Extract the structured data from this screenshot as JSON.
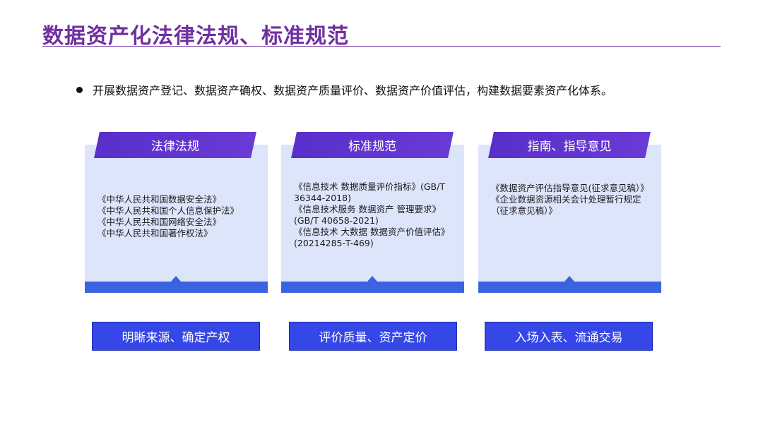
{
  "header": {
    "title": "数据资产化法律法规、标准规范"
  },
  "intro": {
    "bullet": "开展数据资产登记、数据资产确权、数据资产质量评价、数据资产价值评估，构建数据要素资产化体系。"
  },
  "columns": [
    {
      "tab": "法律法规",
      "lines": [
        "《中华人民共和国数据安全法》",
        "《中华人民共和国个人信息保护法》",
        "《中华人民共和国网络安全法》",
        "《中华人民共和国著作权法》"
      ],
      "action": "明晰来源、确定产权"
    },
    {
      "tab": "标准规范",
      "lines": [
        "《信息技术 数据质量评价指标》(GB/T 36344-2018)",
        "《信息技术服务 数据资产 管理要求》(GB/T 40658-2021)",
        "《信息技术 大数据 数据资产价值评估》(20214285-T-469)"
      ],
      "action": "评价质量、资产定价"
    },
    {
      "tab": "指南、指导意见",
      "lines": [
        "《数据资产评估指导意见(征求意见稿）》",
        "《企业数据资源相关会计处理暂行规定（征求意见稿）》"
      ],
      "action": "入场入表、流通交易"
    }
  ],
  "colors": {
    "title": "#7030a0",
    "panel": "#dde5fb",
    "bar": "#3b63e0",
    "tab": "#5a2fc9",
    "action": "#3547e6"
  }
}
